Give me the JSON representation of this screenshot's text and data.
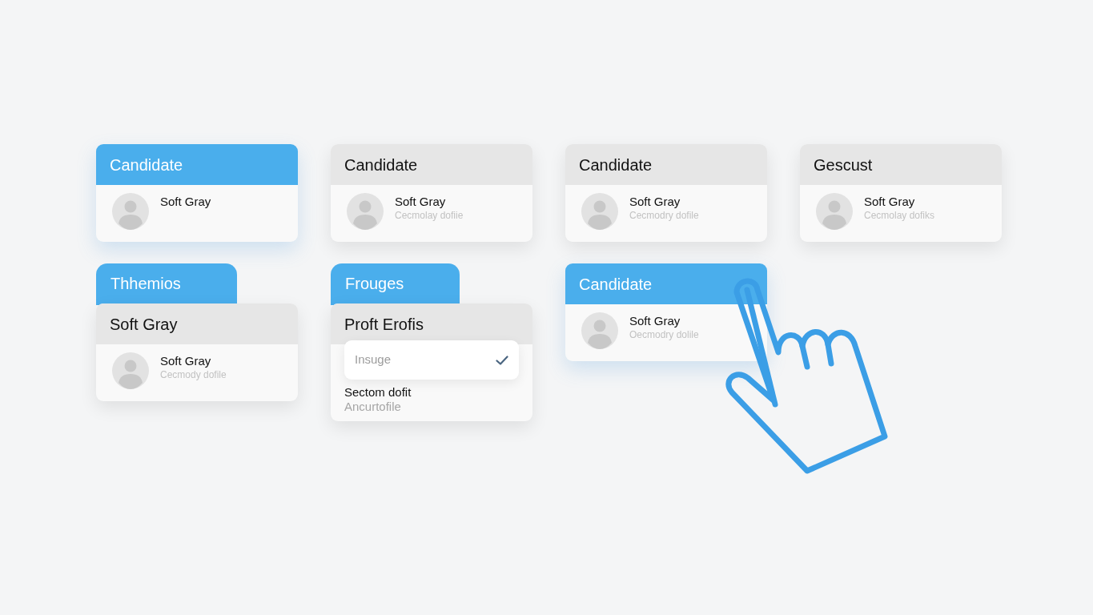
{
  "cards": [
    {
      "kind": "profile",
      "header": {
        "title": "Candidate",
        "selected": true
      },
      "item": {
        "name": "Soft Gray"
      }
    },
    {
      "kind": "profile",
      "header": {
        "title": "Candidate",
        "selected": false
      },
      "item": {
        "name": "Soft Gray",
        "detail": "Cecmolay dofiie"
      }
    },
    {
      "kind": "profile",
      "header": {
        "title": "Candidate",
        "selected": false
      },
      "item": {
        "name": "Soft Gray",
        "detail": "Cecmodry dofile"
      }
    },
    {
      "kind": "profile",
      "header": {
        "title": "Gescust",
        "selected": false
      },
      "item": {
        "name": "Soft Gray",
        "detail": "Cecmolay dofiks"
      }
    },
    {
      "kind": "profile",
      "tab": {
        "label": "Thhemios",
        "selected": true
      },
      "header": {
        "title": "Soft Gray",
        "selected": false
      },
      "item": {
        "name": "Soft Gray",
        "detail": "Cecmody dofile"
      }
    },
    {
      "kind": "select",
      "tab": {
        "label": "Frouges",
        "selected": true
      },
      "header": {
        "title": "Proft Erofis",
        "selected": false
      },
      "select": {
        "value": "Insuge",
        "checked": true
      },
      "item": {
        "name": "Sectom dofit",
        "detail": "Ancurtofile"
      }
    },
    {
      "kind": "profile",
      "header": {
        "title": "Candidate",
        "selected": true
      },
      "item": {
        "name": "Soft Gray",
        "detail": "Oecmodry dolile"
      }
    }
  ]
}
